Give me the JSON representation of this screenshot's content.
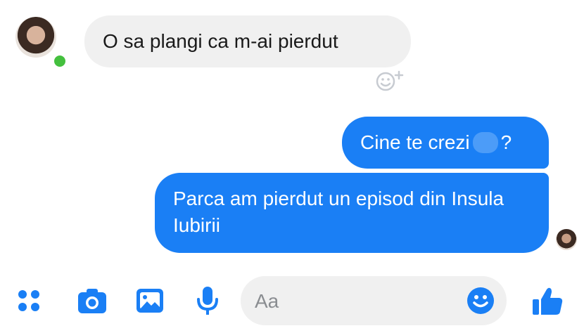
{
  "conversation": {
    "incoming": {
      "text": "O sa plangi ca m-ai pierdut",
      "react_icon": "smile-plus-icon"
    },
    "outgoing": [
      {
        "text_before": "Cine te crezi",
        "text_after": "?"
      },
      {
        "text": "Parca am pierdut un episod din Insula Iubirii"
      }
    ]
  },
  "composer": {
    "placeholder": "Aa"
  },
  "toolbar": {
    "icons": [
      "menu-dots-icon",
      "camera-icon",
      "gallery-icon",
      "microphone-icon",
      "emoji-icon",
      "thumbs-up-icon"
    ]
  },
  "colors": {
    "accent": "#1a7ff5",
    "incoming_bubble": "#f0f0f0",
    "online": "#44c03e"
  }
}
